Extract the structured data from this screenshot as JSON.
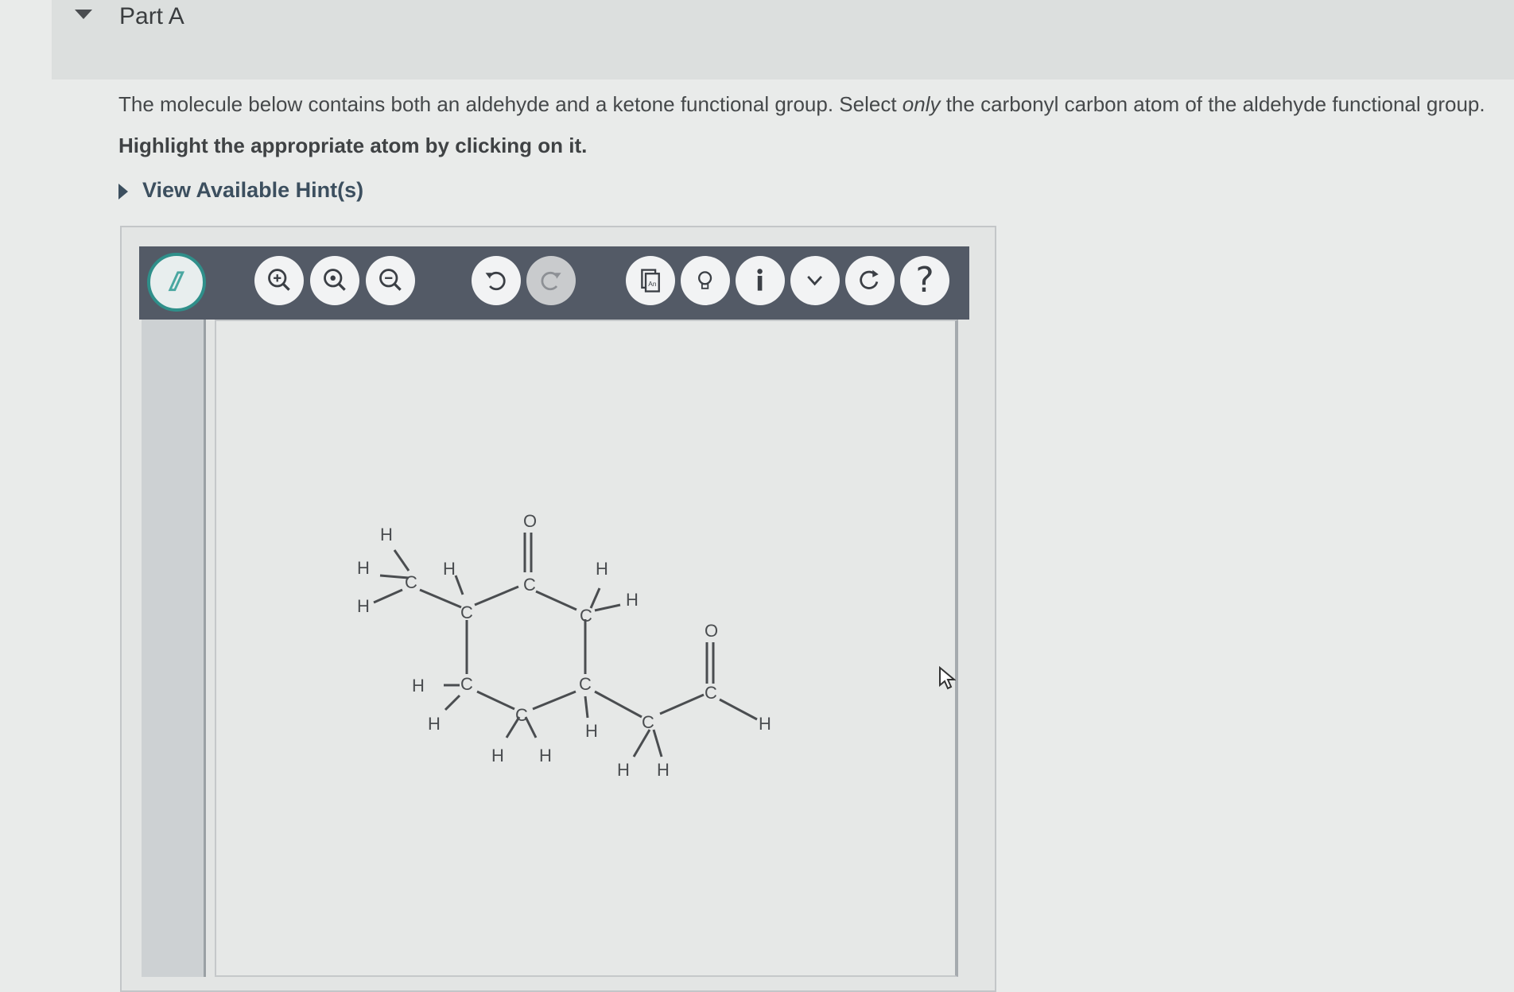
{
  "part": {
    "title": "Part A"
  },
  "question": {
    "text_before": "The molecule below contains both an aldehyde and a ketone functional group. Select ",
    "text_emphasis": "only",
    "text_after": " the carbonyl carbon atom of the aldehyde functional group.",
    "instruction": "Highlight the appropriate atom by clicking on it."
  },
  "hints": {
    "label": "View Available Hint(s)"
  },
  "toolbar": {
    "icons": [
      "highlight-pen-icon",
      "zoom-fit-icon",
      "zoom-in-icon",
      "zoom-out-icon",
      "undo-icon",
      "redo-icon",
      "atom-label-icon",
      "hint-bulb-icon",
      "info-icon",
      "more-chevron-icon",
      "reset-icon",
      "help-icon"
    ],
    "help_label": "?"
  },
  "atoms": {
    "H": "H",
    "C": "C",
    "O": "O"
  },
  "colors": {
    "toolbar": "#535a66",
    "pen_ring": "#2f8f8a",
    "link": "#3c4f5f"
  }
}
